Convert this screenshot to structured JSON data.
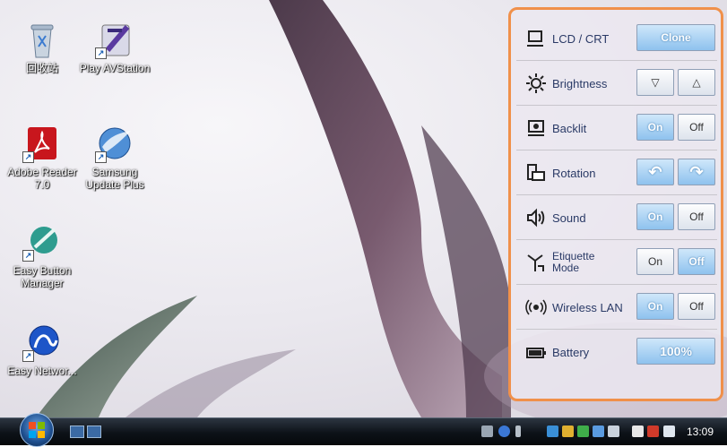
{
  "desktop": {
    "icons": [
      {
        "label": "回收站"
      },
      {
        "label": "Play AVStation"
      },
      {
        "label": "Adobe Reader 7.0"
      },
      {
        "label": "Samsung Update Plus"
      },
      {
        "label": "Easy Button Manager"
      },
      {
        "label": "Easy Networ..."
      }
    ]
  },
  "panel": {
    "accent_color": "#f0904a",
    "rows": [
      {
        "label": "LCD / CRT",
        "icon": "monitor-icon",
        "button": "Clone"
      },
      {
        "label": "Brightness",
        "icon": "sun-icon",
        "down": "▽",
        "up": "△"
      },
      {
        "label": "Backlit",
        "icon": "backlit-icon",
        "on": "On",
        "off": "Off",
        "state": "on"
      },
      {
        "label": "Rotation",
        "icon": "rotation-icon",
        "left": "↶",
        "right": "↷"
      },
      {
        "label": "Sound",
        "icon": "speaker-icon",
        "on": "On",
        "off": "Off",
        "state": "on"
      },
      {
        "label": "Etiquette Mode",
        "icon": "etiquette-icon",
        "on": "On",
        "off": "Off",
        "state": "off"
      },
      {
        "label": "Wireless LAN",
        "icon": "wireless-icon",
        "on": "On",
        "off": "Off",
        "state": "on"
      },
      {
        "label": "Battery",
        "icon": "battery-icon",
        "value": "100%"
      }
    ]
  },
  "taskbar": {
    "clock": "13:09"
  }
}
